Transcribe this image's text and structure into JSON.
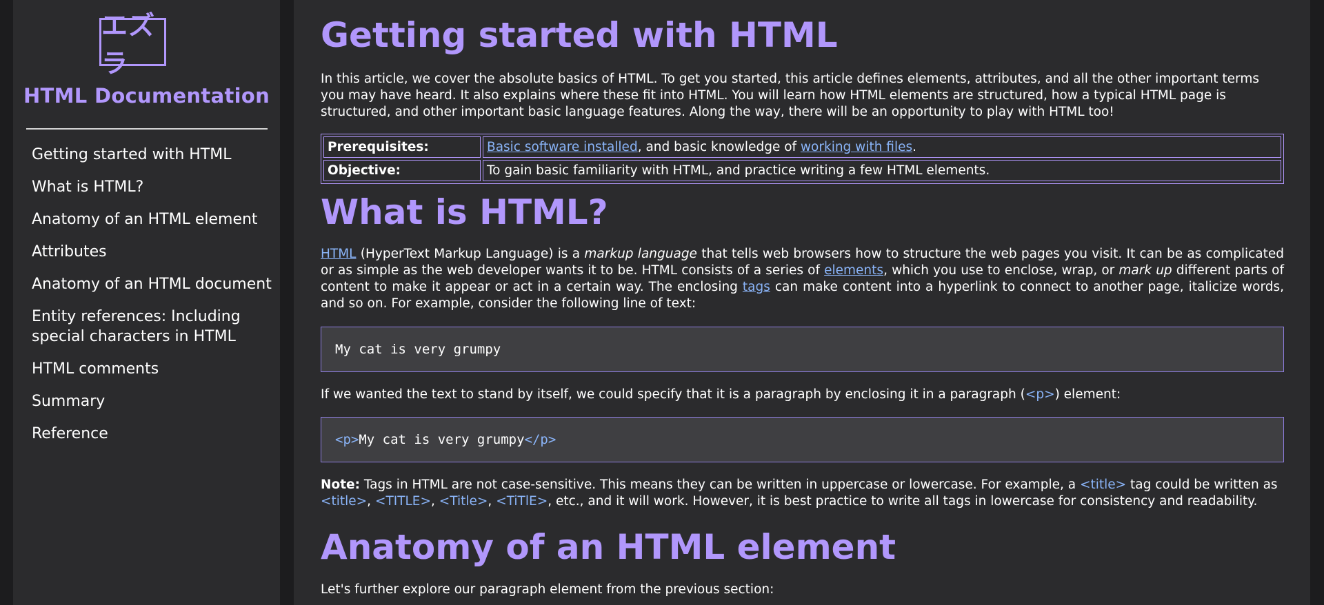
{
  "sidebar": {
    "logo_text": "エズラ",
    "title": "HTML Documentation",
    "items": [
      {
        "label": "Getting started with HTML"
      },
      {
        "label": "What is HTML?"
      },
      {
        "label": "Anatomy of an HTML element"
      },
      {
        "label": "Attributes"
      },
      {
        "label": "Anatomy of an HTML document"
      },
      {
        "label": "Entity references: Including special characters in HTML"
      },
      {
        "label": "HTML comments"
      },
      {
        "label": "Summary"
      },
      {
        "label": "Reference"
      }
    ]
  },
  "main": {
    "h1_getting_started": "Getting started with HTML",
    "intro": "In this article, we cover the absolute basics of HTML. To get you started, this article defines elements, attributes, and all the other important terms you may have heard. It also explains where these fit into HTML. You will learn how HTML elements are structured, how a typical HTML page is structured, and other important basic language features. Along the way, there will be an opportunity to play with HTML too!",
    "table": {
      "prereq_label": "Prerequisites:",
      "prereq_link1": "Basic software installed",
      "prereq_mid": ", and basic knowledge of ",
      "prereq_link2": "working with files",
      "prereq_end": ".",
      "objective_label": "Objective:",
      "objective_value": "To gain basic familiarity with HTML, and practice writing a few HTML elements."
    },
    "h1_what_is": "What is HTML?",
    "what_is": {
      "link_html": "HTML",
      "t1": " (HyperText Markup Language) is a ",
      "em1": "markup language",
      "t2": " that tells web browsers how to structure the web pages you visit. It can be as complicated or as simple as the web developer wants it to be. HTML consists of a series of ",
      "link_elements": "elements",
      "t3": ", which you use to enclose, wrap, or ",
      "em2": "mark up",
      "t4": " different parts of content to make it appear or act in a certain way. The enclosing ",
      "link_tags": "tags",
      "t5": " can make content into a hyperlink to connect to another page, italicize words, and so on. For example, consider the following line of text:"
    },
    "code1": "My cat is very grumpy",
    "para_paragraph": {
      "t1": "If we wanted the text to stand by itself, we could specify that it is a paragraph by enclosing it in a paragraph (",
      "code": "<p>",
      "t2": ") element:"
    },
    "code2": {
      "open": "<p>",
      "text": "My cat is very grumpy",
      "close": "</p>"
    },
    "note": {
      "label": "Note:",
      "t1": " Tags in HTML are not case-sensitive. This means they can be written in uppercase or lowercase. For example, a ",
      "c1": "<title>",
      "t2": " tag could be written as ",
      "c2": "<title>",
      "t3": ", ",
      "c3": "<TITLE>",
      "t4": ", ",
      "c4": "<Title>",
      "t5": ", ",
      "c5": "<TiTlE>",
      "t6": ", etc., and it will work. However, it is best practice to write all tags in lowercase for consistency and readability."
    },
    "h1_anatomy": "Anatomy of an HTML element",
    "anatomy_intro": "Let's further explore our paragraph element from the previous section:"
  },
  "colors": {
    "accent": "#b197fc",
    "link": "#8ab4f8",
    "panel_bg": "#2b2b2d",
    "page_bg": "#1c1c1e",
    "code_bg": "#3f3f42"
  }
}
